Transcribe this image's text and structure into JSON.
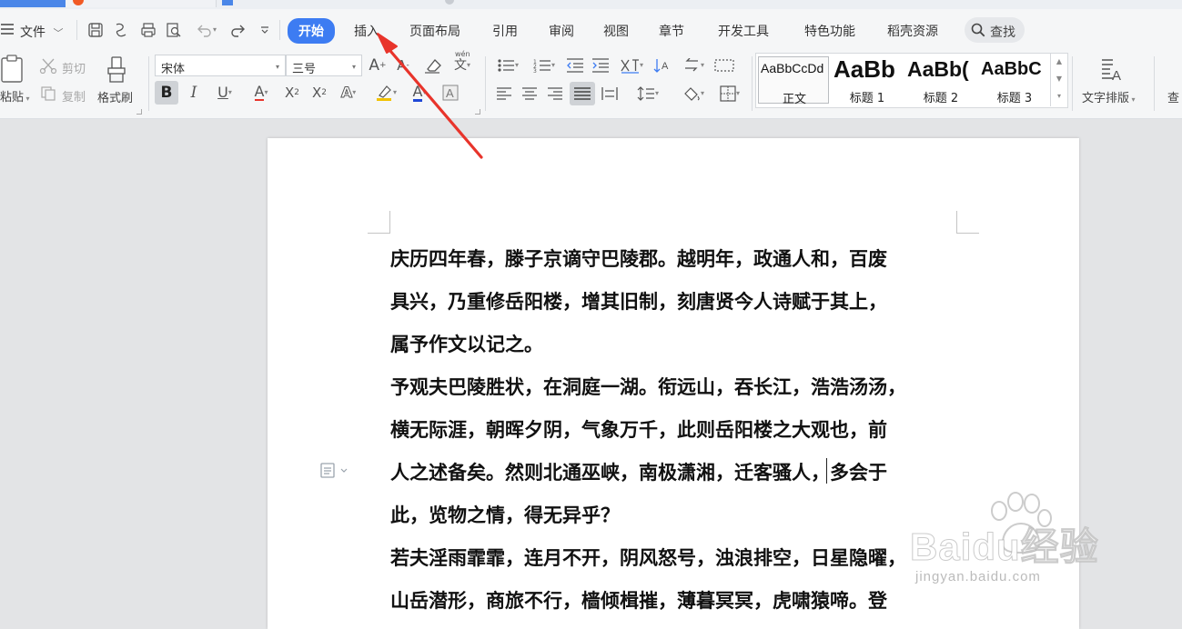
{
  "menu": {
    "file_label": "文件",
    "tabs": [
      {
        "label": "开始"
      },
      {
        "label": "插入"
      },
      {
        "label": "页面布局"
      },
      {
        "label": "引用"
      },
      {
        "label": "审阅"
      },
      {
        "label": "视图"
      },
      {
        "label": "章节"
      },
      {
        "label": "开发工具"
      },
      {
        "label": "特色功能"
      },
      {
        "label": "稻壳资源"
      }
    ],
    "active_tab": "开始",
    "search_label": "查找"
  },
  "ribbon": {
    "paste_label": "粘贴",
    "cut_label": "剪切",
    "copy_label": "复制",
    "format_painter_label": "格式刷",
    "font_name": "宋体",
    "font_size": "三号",
    "styles": [
      {
        "preview": "AaBbCcDd",
        "name": "正文"
      },
      {
        "preview": "AaBb",
        "name": "标题 1"
      },
      {
        "preview": "AaBb(",
        "name": "标题 2"
      },
      {
        "preview": "AaBbC",
        "name": "标题 3"
      }
    ],
    "text_layout_label": "文字排版",
    "find_label_clipped": "查"
  },
  "document": {
    "lines": [
      "庆历四年春，滕子京谪守巴陵郡。越明年，政通人和，百废",
      "具兴，乃重修岳阳楼，增其旧制，刻唐贤今人诗赋于其上，",
      "属予作文以记之。",
      "予观夫巴陵胜状，在洞庭一湖。衔远山，吞长江，浩浩汤汤，",
      "横无际涯，朝晖夕阴，气象万千，此则岳阳楼之大观也，前",
      "人之述备矣。然则北通巫峡，南极潇湘，迁客骚人，多会于",
      "此，览物之情，得无异乎？",
      "若夫淫雨霏霏，连月不开，阴风怒号，浊浪排空，日星隐曜，",
      "山岳潜形，商旅不行，樯倾楫摧，薄暮冥冥，虎啸猿啼。登"
    ]
  },
  "watermark": {
    "logo_text": "Baidu经验",
    "url_text": "jingyan.baidu.com"
  },
  "colors": {
    "accent": "#3d7cf2",
    "annotation_arrow": "#e8342b",
    "font_color_underline": "#1f48d6",
    "highlight_underline": "#f2c200"
  }
}
